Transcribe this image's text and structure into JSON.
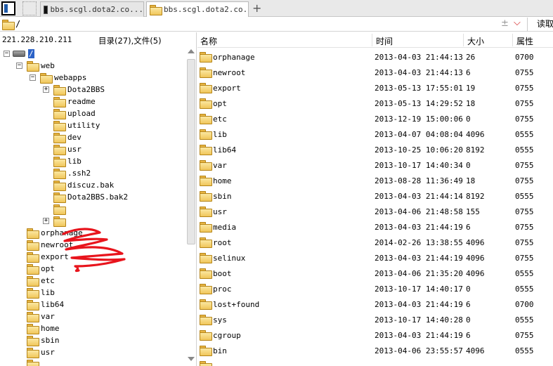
{
  "tabs": [
    {
      "label": "bbs.scgl.dota2.co..."
    },
    {
      "label": "bbs.scgl.dota2.co..."
    }
  ],
  "new_tab_label": "+",
  "path": {
    "value": "/",
    "plus_minus": "±",
    "dropdown": "⌵",
    "read_label": "读取"
  },
  "left": {
    "ip": "221.228.210.211",
    "counts": "目录(27),文件(5)",
    "root_label": "/",
    "tree": [
      {
        "label": "web",
        "level": 1,
        "expander": "−"
      },
      {
        "label": "webapps",
        "level": 2,
        "expander": "−"
      },
      {
        "label": "Dota2BBS",
        "level": 3,
        "expander": "+"
      },
      {
        "label": "readme",
        "level": 3,
        "expander": ""
      },
      {
        "label": "upload",
        "level": 3,
        "expander": ""
      },
      {
        "label": "utility",
        "level": 3,
        "expander": ""
      },
      {
        "label": "dev",
        "level": 3,
        "expander": ""
      },
      {
        "label": "usr",
        "level": 3,
        "expander": ""
      },
      {
        "label": "lib",
        "level": 3,
        "expander": ""
      },
      {
        "label": ".ssh2",
        "level": 3,
        "expander": ""
      },
      {
        "label": "discuz.bak",
        "level": 3,
        "expander": ""
      },
      {
        "label": "Dota2BBS.bak2",
        "level": 3,
        "expander": ""
      },
      {
        "label": "",
        "level": 3,
        "expander": ""
      },
      {
        "label": "",
        "level": 3,
        "expander": "+"
      },
      {
        "label": "orphanage",
        "level": 1,
        "expander": ""
      },
      {
        "label": "newroot",
        "level": 1,
        "expander": ""
      },
      {
        "label": "export",
        "level": 1,
        "expander": ""
      },
      {
        "label": "opt",
        "level": 1,
        "expander": ""
      },
      {
        "label": "etc",
        "level": 1,
        "expander": ""
      },
      {
        "label": "lib",
        "level": 1,
        "expander": ""
      },
      {
        "label": "lib64",
        "level": 1,
        "expander": ""
      },
      {
        "label": "var",
        "level": 1,
        "expander": ""
      },
      {
        "label": "home",
        "level": 1,
        "expander": ""
      },
      {
        "label": "sbin",
        "level": 1,
        "expander": ""
      },
      {
        "label": "usr",
        "level": 1,
        "expander": ""
      },
      {
        "label": "",
        "level": 1,
        "expander": ""
      }
    ]
  },
  "columns": {
    "name": "名称",
    "time": "时间",
    "size": "大小",
    "attr": "属性"
  },
  "files": [
    {
      "name": "orphanage",
      "time": "2013-04-03 21:44:13",
      "size": "26",
      "attr": "0700"
    },
    {
      "name": "newroot",
      "time": "2013-04-03 21:44:13",
      "size": "6",
      "attr": "0755"
    },
    {
      "name": "export",
      "time": "2013-05-13 17:55:01",
      "size": "19",
      "attr": "0755"
    },
    {
      "name": "opt",
      "time": "2013-05-13 14:29:52",
      "size": "18",
      "attr": "0755"
    },
    {
      "name": "etc",
      "time": "2013-12-19 15:00:06",
      "size": "0",
      "attr": "0755"
    },
    {
      "name": "lib",
      "time": "2013-04-07 04:08:04",
      "size": "4096",
      "attr": "0555"
    },
    {
      "name": "lib64",
      "time": "2013-10-25 10:06:20",
      "size": "8192",
      "attr": "0555"
    },
    {
      "name": "var",
      "time": "2013-10-17 14:40:34",
      "size": "0",
      "attr": "0755"
    },
    {
      "name": "home",
      "time": "2013-08-28 11:36:49",
      "size": "18",
      "attr": "0755"
    },
    {
      "name": "sbin",
      "time": "2013-04-03 21:44:14",
      "size": "8192",
      "attr": "0555"
    },
    {
      "name": "usr",
      "time": "2013-04-06 21:48:58",
      "size": "155",
      "attr": "0755"
    },
    {
      "name": "media",
      "time": "2013-04-03 21:44:19",
      "size": "6",
      "attr": "0755"
    },
    {
      "name": "root",
      "time": "2014-02-26 13:38:55",
      "size": "4096",
      "attr": "0755"
    },
    {
      "name": "selinux",
      "time": "2013-04-03 21:44:19",
      "size": "4096",
      "attr": "0755"
    },
    {
      "name": "boot",
      "time": "2013-04-06 21:35:20",
      "size": "4096",
      "attr": "0555"
    },
    {
      "name": "proc",
      "time": "2013-10-17 14:40:17",
      "size": "0",
      "attr": "0555"
    },
    {
      "name": "lost+found",
      "time": "2013-04-03 21:44:19",
      "size": "6",
      "attr": "0700"
    },
    {
      "name": "sys",
      "time": "2013-10-17 14:40:28",
      "size": "0",
      "attr": "0555"
    },
    {
      "name": "cgroup",
      "time": "2013-04-03 21:44:19",
      "size": "6",
      "attr": "0755"
    },
    {
      "name": "bin",
      "time": "2013-04-06 23:55:57",
      "size": "4096",
      "attr": "0555"
    },
    {
      "name": "",
      "time": "",
      "size": "",
      "attr": ""
    }
  ],
  "colors": {
    "accent": "#2b62c7",
    "folder": "#f0c65a",
    "scribble": "#e8141c"
  }
}
